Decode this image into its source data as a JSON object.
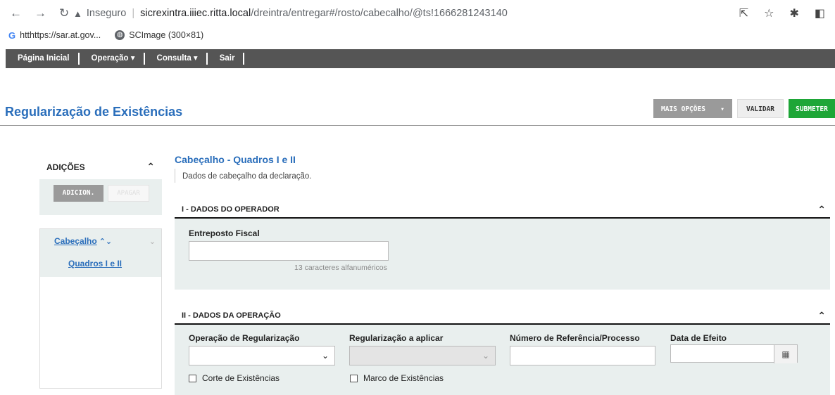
{
  "browser": {
    "url_prefix": "Inseguro",
    "url_host": "sicrexintra.iiiec.ritta.local",
    "url_path": "/dreintra/entregar#/rosto/cabecalho/@ts!1666281243140",
    "bookmarks": [
      "htthttps://sar.at.gov...",
      "SCImage (300×81)"
    ]
  },
  "appnav": [
    "Página Inicial",
    "Operação ▾",
    "Consulta ▾",
    "Sair"
  ],
  "page": {
    "title": "Regularização de Existências",
    "actions": {
      "more": "MAIS OPÇÕES",
      "validate": "VALIDAR",
      "submit": "SUBMETER"
    }
  },
  "sidebar": {
    "header": "ADIÇÕES",
    "add": "ADICION.",
    "delete": "APAGAR",
    "tree": {
      "node": "Cabeçalho",
      "leaf": "Quadros I e II"
    }
  },
  "main": {
    "title": "Cabeçalho - Quadros I e II",
    "description": "Dados de cabeçalho da declaração.",
    "section1": {
      "title": "I - DADOS DO OPERADOR",
      "field_label": "Entreposto Fiscal",
      "field_value": "",
      "hint": "13 caracteres alfanuméricos"
    },
    "section2": {
      "title": "II - DADOS DA OPERAÇÃO",
      "op_label": "Operação de Regularização",
      "reg_label": "Regularização a aplicar",
      "ref_label": "Número de Referência/Processo",
      "date_label": "Data de Efeito",
      "chk1": "Corte de Existências",
      "chk2": "Marco de Existências"
    }
  },
  "colors": {
    "accent": "#2a6ebb",
    "submit": "#1ea637",
    "navbar": "#555555",
    "panel": "#e9efee"
  }
}
